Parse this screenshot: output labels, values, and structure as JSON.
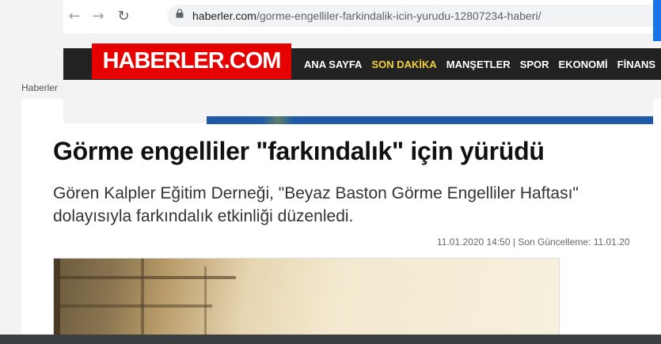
{
  "browser": {
    "url_host": "haberler.com",
    "url_path": "/gorme-engelliler-farkindalik-icin-yurudu-12807234-haberi/",
    "icons": [
      "back-arrow-icon",
      "forward-arrow-icon",
      "reload-icon",
      "lock-icon"
    ]
  },
  "site": {
    "logo_text": "HABERLER.COM",
    "menu": [
      {
        "label": "ANA SAYFA",
        "active": false
      },
      {
        "label": "SON DAKİKA",
        "active": true
      },
      {
        "label": "MANŞETLER",
        "active": false
      },
      {
        "label": "SPOR",
        "active": false
      },
      {
        "label": "EKONOMİ",
        "active": false
      },
      {
        "label": "FİNANS",
        "active": false
      }
    ],
    "brand_color": "#e60000",
    "active_menu_color": "#f4d03f"
  },
  "breadcrumb": "Haberler",
  "article": {
    "headline": "Görme engelliler \"farkındalık\" için yürüdü",
    "summary": "Gören Kalpler Eğitim Derneği, \"Beyaz Baston Görme Engelliler Haftası\" dolayısıyla farkındalık etkinliği düzenledi.",
    "meta": "11.01.2020 14:50 | Son Güncelleme: 11.01.20"
  }
}
